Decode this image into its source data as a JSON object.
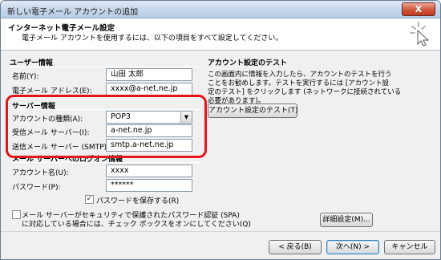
{
  "window": {
    "title": "新しい電子メール アカウントの追加",
    "close_label": "X"
  },
  "header": {
    "title": "インターネット電子メール設定",
    "subtitle": "電子メール アカウントを使用するには、以下の項目をすべて設定してください。"
  },
  "user_info": {
    "section_title": "ユーザー情報",
    "name_label": "名前(Y):",
    "name_value": "山田 太郎",
    "email_label": "電子メール アドレス(E):",
    "email_value": "xxxx@a-net.ne.jp"
  },
  "server_info": {
    "section_title": "サーバー情報",
    "account_type_label": "アカウントの種類(A):",
    "account_type_value": "POP3",
    "incoming_label": "受信メール サーバー(I):",
    "incoming_value": "a-net.ne.jp",
    "outgoing_label": "送信メール サーバー (SMTP)(O):",
    "outgoing_value": "smtp.a-net.ne.jp"
  },
  "logon_info": {
    "section_title": "メール サーバーへのログオン情報",
    "account_label": "アカウント名(U):",
    "account_value": "xxxx",
    "password_label": "パスワード(P):",
    "password_value": "******",
    "save_password_label": "パスワードを保存する(R)",
    "save_password_checked": true,
    "spa_label_line1": "メール サーバーがセキュリティで保護されたパスワード認証 (SPA)",
    "spa_label_line2": "に対応している場合には、チェック ボックスをオンにしてください(Q)",
    "spa_checked": false
  },
  "test": {
    "section_title": "アカウント設定のテスト",
    "description_lines": [
      "この画面内に情報を入力したら、アカウントのテストを行う",
      "ことをお勧めします。テストを実行するには [アカウント設",
      "定のテスト] をクリックします (ネットワークに接続されている",
      "必要があります)。"
    ],
    "test_button": "アカウント設定のテスト(T)",
    "advanced_button": "詳細設定(M)..."
  },
  "footer": {
    "back_button": "< 戻る(B)",
    "next_button": "次へ(N) >",
    "cancel_button": "キャンセル"
  }
}
